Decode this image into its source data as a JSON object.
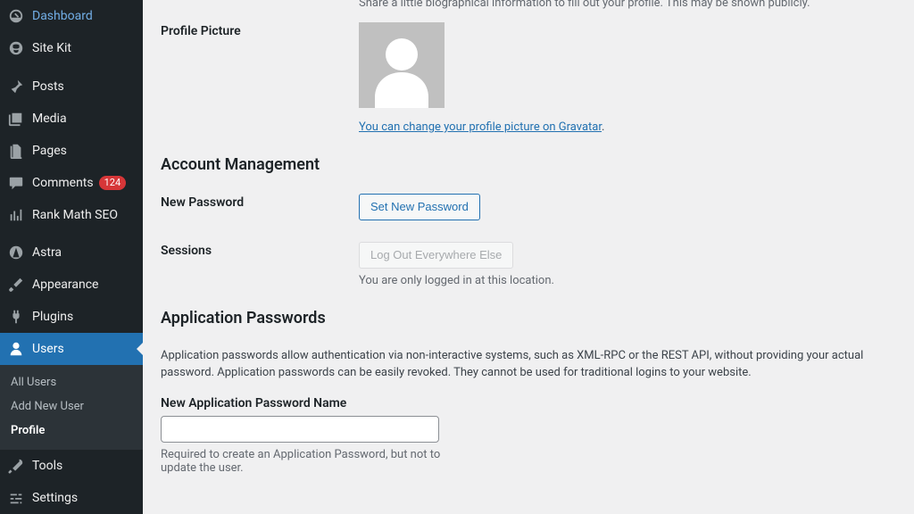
{
  "sidebar": {
    "items": [
      {
        "icon": "dashboard",
        "label": "Dashboard"
      },
      {
        "icon": "sitekit",
        "label": "Site Kit"
      },
      {
        "icon": "pin",
        "label": "Posts"
      },
      {
        "icon": "media",
        "label": "Media"
      },
      {
        "icon": "pages",
        "label": "Pages"
      },
      {
        "icon": "comment",
        "label": "Comments",
        "badge": "124"
      },
      {
        "icon": "chart",
        "label": "Rank Math SEO"
      },
      {
        "icon": "astra",
        "label": "Astra"
      },
      {
        "icon": "brush",
        "label": "Appearance"
      },
      {
        "icon": "plug",
        "label": "Plugins"
      },
      {
        "icon": "user",
        "label": "Users",
        "current": true
      },
      {
        "icon": "wrench",
        "label": "Tools"
      },
      {
        "icon": "sliders",
        "label": "Settings"
      }
    ],
    "submenu": {
      "items": [
        {
          "label": "All Users"
        },
        {
          "label": "Add New User"
        },
        {
          "label": "Profile",
          "current": true
        }
      ]
    }
  },
  "profile": {
    "bio_desc_cut": "Share a little biographical information to fill out your profile. This may be shown publicly.",
    "picture": {
      "label": "Profile Picture",
      "gravatar_link": "You can change your profile picture on Gravatar",
      "period": "."
    },
    "account_heading": "Account Management",
    "new_password": {
      "label": "New Password",
      "button": "Set New Password"
    },
    "sessions": {
      "label": "Sessions",
      "button": "Log Out Everywhere Else",
      "desc": "You are only logged in at this location."
    },
    "app_pw": {
      "heading": "Application Passwords",
      "desc": "Application passwords allow authentication via non-interactive systems, such as XML-RPC or the REST API, without providing your actual password. Application passwords can be easily revoked. They cannot be used for traditional logins to your website.",
      "field_label": "New Application Password Name",
      "value": "",
      "help": "Required to create an Application Password, but not to update the user."
    }
  }
}
